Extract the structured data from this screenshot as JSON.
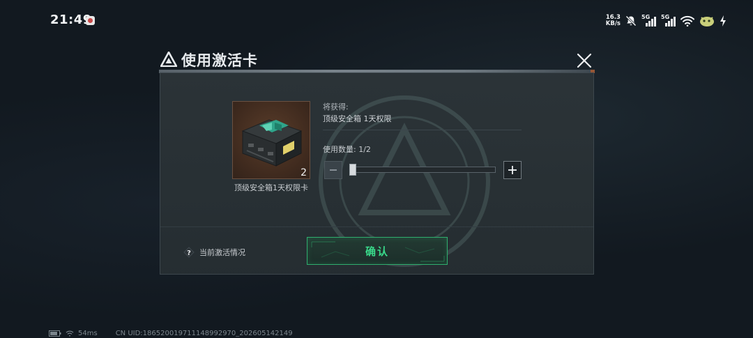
{
  "status_bar": {
    "time": "21:49",
    "net_speed_value": "16.3",
    "net_speed_unit": "KB/s",
    "signal_1_label": "5G",
    "signal_2_label": "5G"
  },
  "dialog": {
    "title": "使用激活卡",
    "item": {
      "name": "顶级安全箱1天权限卡",
      "quantity": "2"
    },
    "obtain_label": "将获得:",
    "obtain_value": "顶级安全箱 1天权限",
    "use_quantity_label": "使用数量:",
    "use_quantity_value": "1/2",
    "slider": {
      "value": 1,
      "min": 1,
      "max": 2
    },
    "help_icon_glyph": "?",
    "help_text": "当前激活情况",
    "confirm_label": "确认"
  },
  "footer": {
    "ping": "54ms",
    "uid": "CN UID:18652001971114899​2970_202605142149"
  },
  "colors": {
    "accent_green": "#39d98a",
    "confirm_border": "#2fae6e",
    "background": "#121920",
    "panel": "#2c3438"
  }
}
